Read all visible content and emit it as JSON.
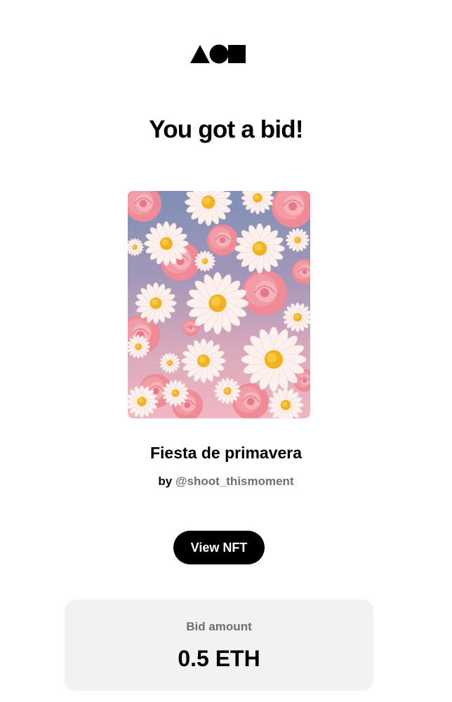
{
  "header": {
    "logo_icon": "triangle-circle-square-logo"
  },
  "title": "You got a bid!",
  "nft": {
    "image_icon": "flower-artwork",
    "name": "Fiesta de primavera",
    "by_label": "by",
    "creator": "@shoot_thismoment"
  },
  "actions": {
    "view_label": "View NFT"
  },
  "bid": {
    "label": "Bid amount",
    "value": "0.5 ETH"
  },
  "colors": {
    "button": "#000000",
    "card_background": "#f2f2f2",
    "muted_text": "#6f6f6f"
  }
}
